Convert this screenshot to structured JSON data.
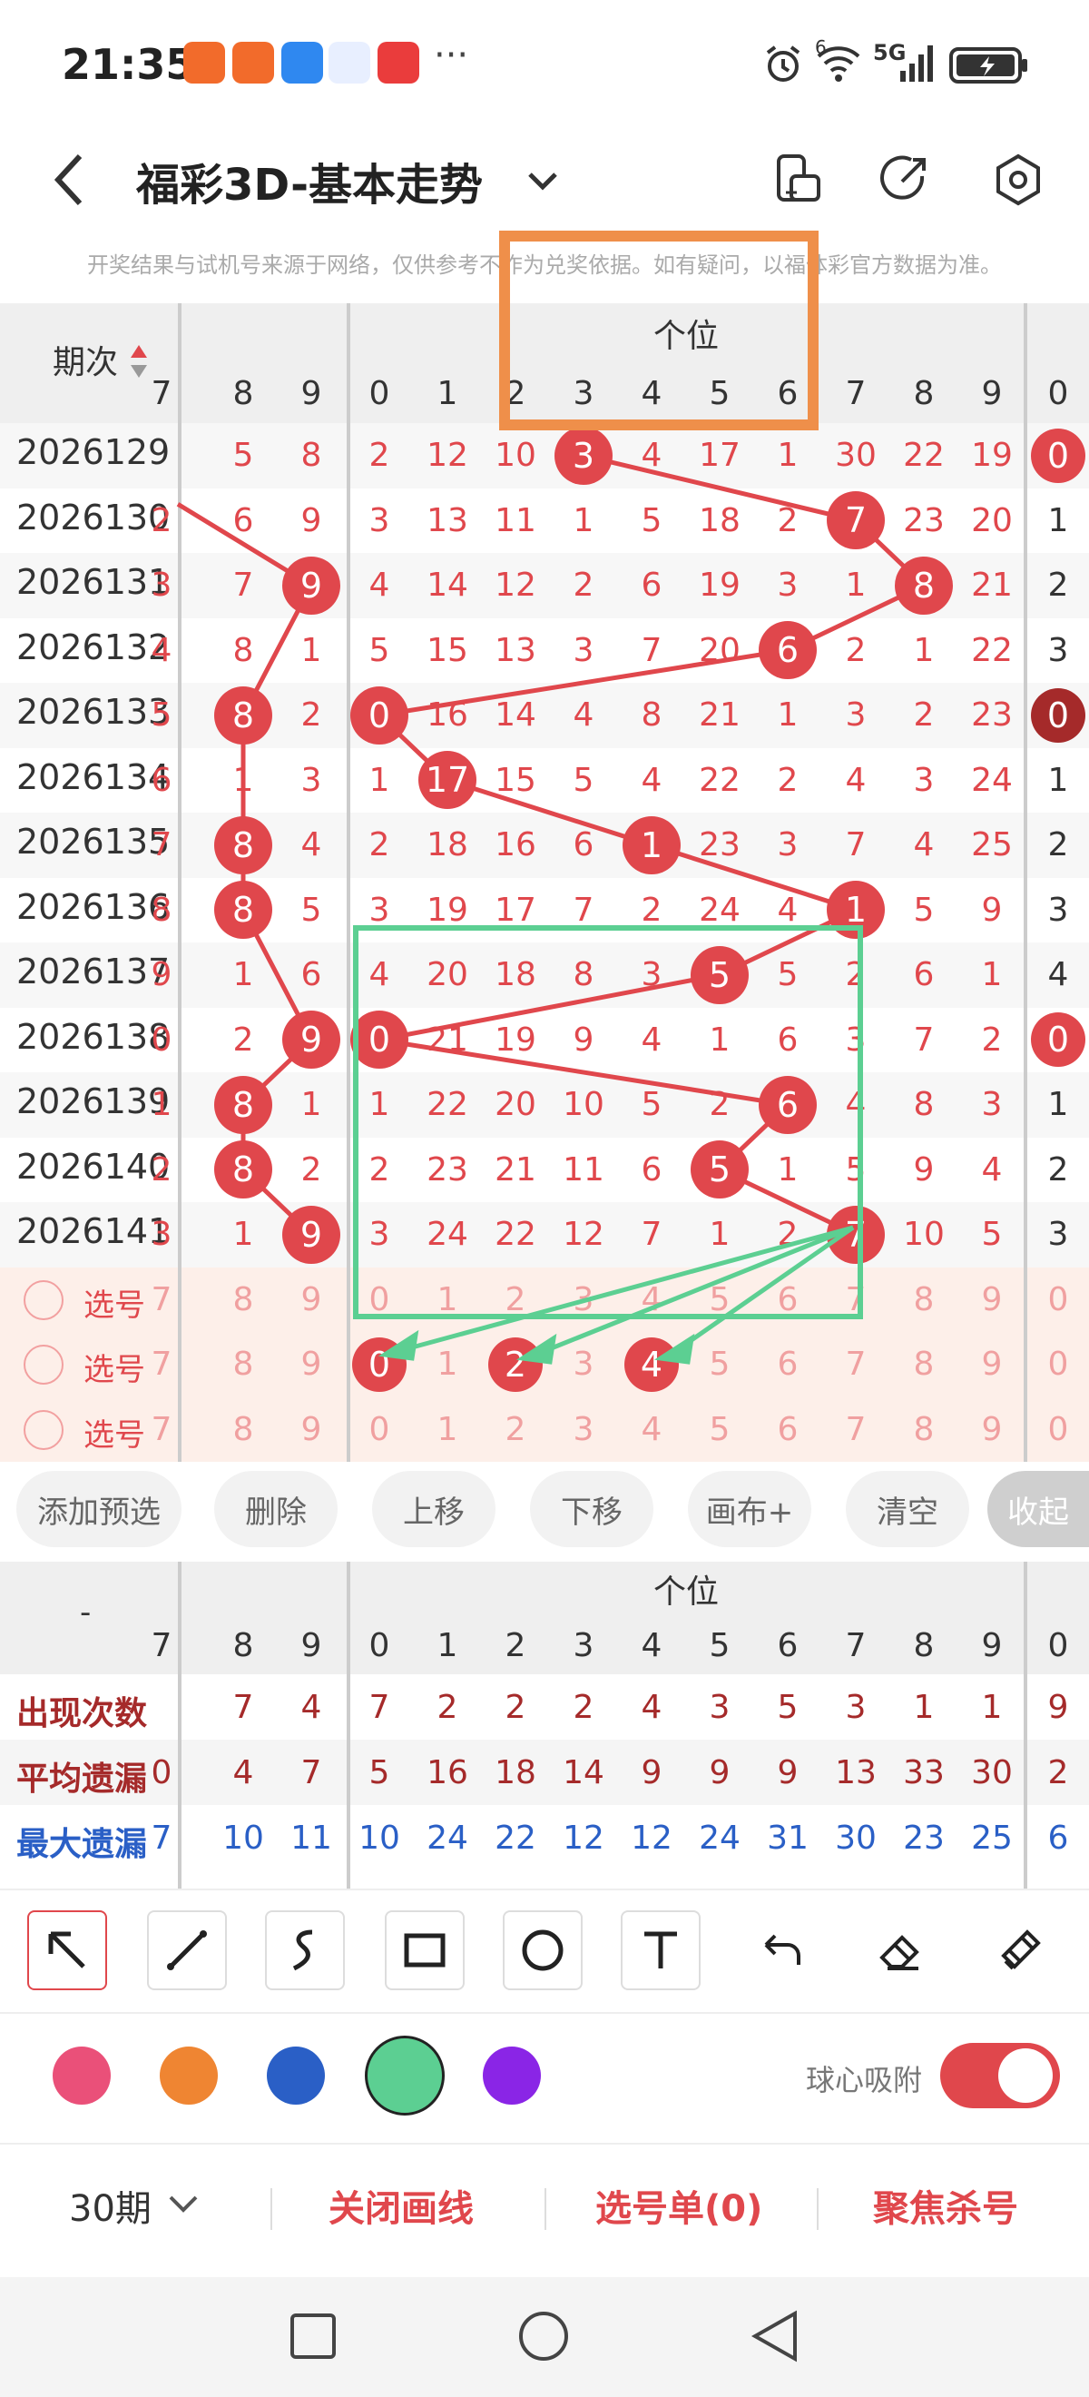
{
  "status_bar": {
    "time": "21:35",
    "network": "5G",
    "wifi_label": "6"
  },
  "header": {
    "title": "福彩3D-基本走势"
  },
  "notice": "开奖结果与试机号来源于网络，仅供参考不作为兑奖依据。如有疑问，以福体彩官方数据为准。",
  "table": {
    "period_header": "期次",
    "group_label": "个位",
    "col_headers": [
      "7",
      "8",
      "9",
      "0",
      "1",
      "2",
      "3",
      "4",
      "5",
      "6",
      "7",
      "8",
      "9",
      "0"
    ],
    "rows": [
      {
        "period": "2026129",
        "cells": [
          "",
          "5",
          "8",
          "2",
          "12",
          "10",
          "3",
          "4",
          "17",
          "1",
          "30",
          "22",
          "19",
          "0"
        ]
      },
      {
        "period": "2026130",
        "cells": [
          "2",
          "6",
          "9",
          "3",
          "13",
          "11",
          "1",
          "5",
          "18",
          "2",
          "7",
          "23",
          "20",
          "1"
        ]
      },
      {
        "period": "2026131",
        "cells": [
          "3",
          "7",
          "9",
          "4",
          "14",
          "12",
          "2",
          "6",
          "19",
          "3",
          "1",
          "8",
          "21",
          "2"
        ]
      },
      {
        "period": "2026132",
        "cells": [
          "4",
          "8",
          "1",
          "5",
          "15",
          "13",
          "3",
          "7",
          "20",
          "6",
          "2",
          "1",
          "22",
          "3"
        ]
      },
      {
        "period": "2026133",
        "cells": [
          "5",
          "8",
          "2",
          "0",
          "16",
          "14",
          "4",
          "8",
          "21",
          "1",
          "3",
          "2",
          "23",
          "0"
        ]
      },
      {
        "period": "2026134",
        "cells": [
          "6",
          "1",
          "3",
          "1",
          "17",
          "15",
          "5",
          "4",
          "22",
          "2",
          "4",
          "3",
          "24",
          "1"
        ]
      },
      {
        "period": "2026135",
        "cells": [
          "7",
          "8",
          "4",
          "2",
          "18",
          "16",
          "6",
          "1",
          "23",
          "3",
          "7",
          "4",
          "25",
          "2"
        ]
      },
      {
        "period": "2026136",
        "cells": [
          "8",
          "8",
          "5",
          "3",
          "19",
          "17",
          "7",
          "2",
          "24",
          "4",
          "1",
          "5",
          "9",
          "3"
        ]
      },
      {
        "period": "2026137",
        "cells": [
          "9",
          "1",
          "6",
          "4",
          "20",
          "18",
          "8",
          "3",
          "5",
          "5",
          "2",
          "6",
          "1",
          "4"
        ]
      },
      {
        "period": "2026138",
        "cells": [
          "0",
          "2",
          "9",
          "0",
          "21",
          "19",
          "9",
          "4",
          "1",
          "6",
          "3",
          "7",
          "2",
          "0"
        ]
      },
      {
        "period": "2026139",
        "cells": [
          "1",
          "8",
          "1",
          "1",
          "22",
          "20",
          "10",
          "5",
          "2",
          "6",
          "4",
          "8",
          "3",
          "1"
        ]
      },
      {
        "period": "2026140",
        "cells": [
          "2",
          "8",
          "2",
          "2",
          "23",
          "21",
          "11",
          "6",
          "5",
          "1",
          "5",
          "9",
          "4",
          "2"
        ]
      },
      {
        "period": "2026141",
        "cells": [
          "3",
          "1",
          "9",
          "3",
          "24",
          "22",
          "12",
          "7",
          "1",
          "2",
          "7",
          "10",
          "5",
          "3"
        ]
      }
    ],
    "select_label": "选号",
    "select_cells": [
      "7",
      "8",
      "9",
      "0",
      "1",
      "2",
      "3",
      "4",
      "5",
      "6",
      "7",
      "8",
      "9",
      "0"
    ]
  },
  "actions": {
    "add": "添加预选",
    "delete": "删除",
    "up": "上移",
    "down": "下移",
    "canvas": "画布+",
    "clear": "清空",
    "collapse": "收起"
  },
  "stats": {
    "corner": "-",
    "group_label": "个位",
    "col_headers": [
      "7",
      "8",
      "9",
      "0",
      "1",
      "2",
      "3",
      "4",
      "5",
      "6",
      "7",
      "8",
      "9",
      "0"
    ],
    "rows": [
      {
        "label": "出现次数",
        "cells": [
          "",
          "7",
          "4",
          "7",
          "2",
          "2",
          "2",
          "4",
          "3",
          "5",
          "3",
          "1",
          "1",
          "9"
        ]
      },
      {
        "label": "平均遗漏",
        "cells": [
          "0",
          "4",
          "7",
          "5",
          "16",
          "18",
          "14",
          "9",
          "9",
          "9",
          "13",
          "33",
          "30",
          "2"
        ]
      },
      {
        "label": "最大遗漏",
        "cells": [
          "7",
          "10",
          "11",
          "10",
          "24",
          "22",
          "12",
          "12",
          "24",
          "31",
          "30",
          "23",
          "25",
          "6"
        ]
      }
    ]
  },
  "draw_colors": [
    "#ea5079",
    "#ef8532",
    "#2a5fc6",
    "#5ccf92",
    "#8a25e6"
  ],
  "snap_label": "球心吸附",
  "bottom": {
    "period_select": "30期",
    "close_lines": "关闭画线",
    "select_list": "选号单(0)",
    "focus_kill": "聚焦杀号"
  }
}
